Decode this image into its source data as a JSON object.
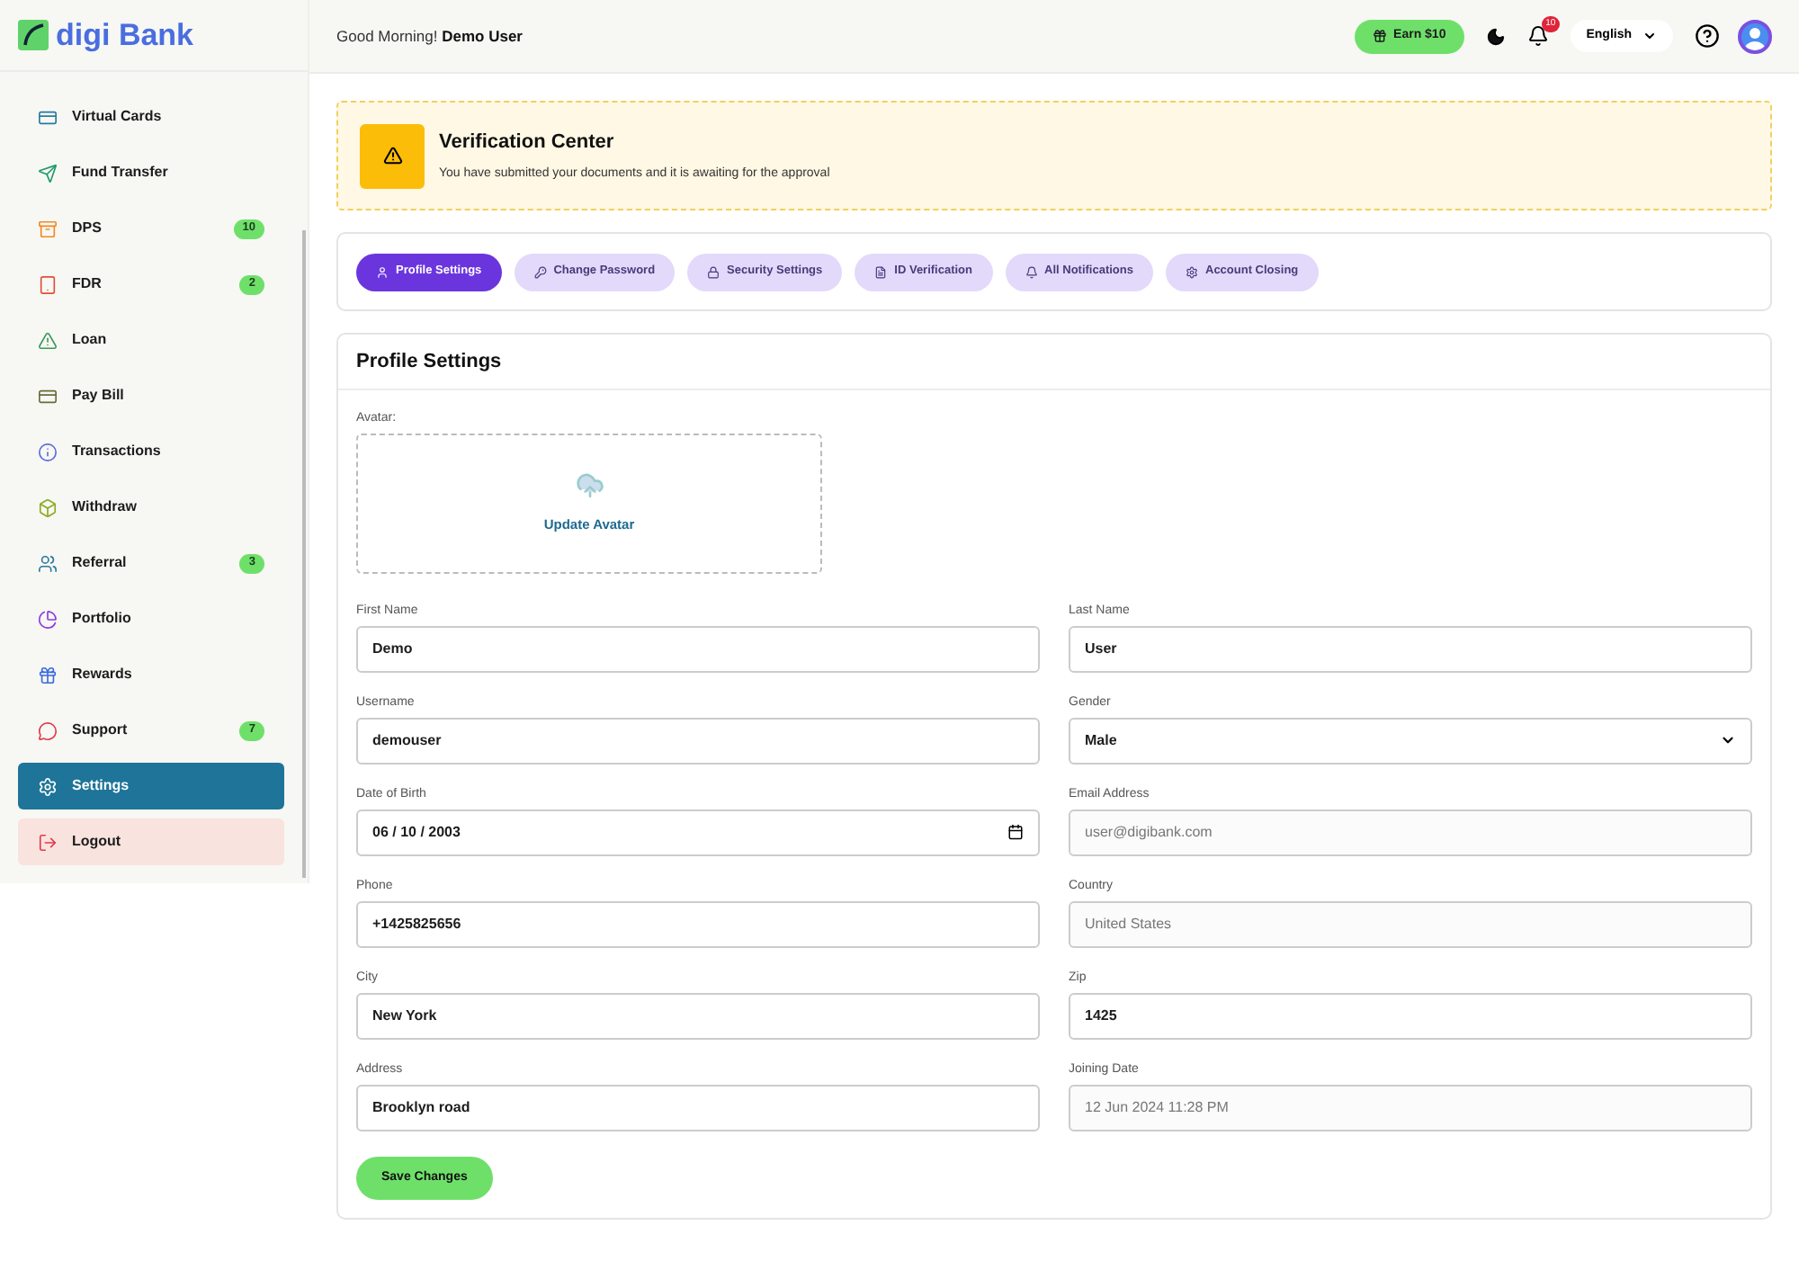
{
  "brand": {
    "name": "digi Bank"
  },
  "sidebar": {
    "items": [
      {
        "label": "Virtual Cards",
        "kind": "link",
        "selected": false
      },
      {
        "label": "Fund Transfer",
        "kind": "link",
        "selected": false
      },
      {
        "label": "DPS",
        "kind": "link",
        "selected": false,
        "badge": "10"
      },
      {
        "label": "FDR",
        "kind": "link",
        "selected": false,
        "badge": "2"
      },
      {
        "label": "Loan",
        "kind": "link",
        "selected": false
      },
      {
        "label": "Pay Bill",
        "kind": "link",
        "selected": false
      },
      {
        "label": "Transactions",
        "kind": "link",
        "selected": false
      },
      {
        "label": "Withdraw",
        "kind": "link",
        "selected": false
      },
      {
        "label": "Referral",
        "kind": "link",
        "selected": false,
        "badge": "3"
      },
      {
        "label": "Portfolio",
        "kind": "link",
        "selected": false
      },
      {
        "label": "Rewards",
        "kind": "link",
        "selected": false
      },
      {
        "label": "Support",
        "kind": "link",
        "selected": false,
        "badge": "7"
      },
      {
        "label": "Settings",
        "kind": "link",
        "selected": true
      },
      {
        "label": "Logout",
        "kind": "logout",
        "selected": false
      }
    ]
  },
  "header": {
    "greeting": "Good Morning!",
    "user": "Demo User",
    "earn_button": "Earn $10",
    "notification_count": "10",
    "language": "English"
  },
  "verification": {
    "title": "Verification Center",
    "message": "You have submitted your documents and it is awaiting for the approval"
  },
  "tabs": [
    {
      "label": "Profile Settings",
      "selected": true
    },
    {
      "label": "Change Password",
      "selected": false
    },
    {
      "label": "Security Settings",
      "selected": false
    },
    {
      "label": "ID Verification",
      "selected": false
    },
    {
      "label": "All Notifications",
      "selected": false
    },
    {
      "label": "Account Closing",
      "selected": false
    }
  ],
  "profile": {
    "title": "Profile Settings",
    "avatar_label": "Avatar:",
    "avatar_action": "Update Avatar",
    "fields": [
      {
        "label": "First Name",
        "value": "Demo",
        "kind": "text",
        "disabled": false
      },
      {
        "label": "Last Name",
        "value": "User",
        "kind": "text",
        "disabled": false
      },
      {
        "label": "Username",
        "value": "demouser",
        "kind": "text",
        "disabled": false
      },
      {
        "label": "Gender",
        "value": "Male",
        "kind": "select",
        "disabled": false
      },
      {
        "label": "Date of Birth",
        "value": "06 / 10 / 2003",
        "kind": "date",
        "disabled": false
      },
      {
        "label": "Email Address",
        "value": "user@digibank.com",
        "kind": "text",
        "disabled": true
      },
      {
        "label": "Phone",
        "value": "+1425825656",
        "kind": "text",
        "disabled": false
      },
      {
        "label": "Country",
        "value": "United States",
        "kind": "text",
        "disabled": true
      },
      {
        "label": "City",
        "value": "New York",
        "kind": "text",
        "disabled": false
      },
      {
        "label": "Zip",
        "value": "1425",
        "kind": "text",
        "disabled": false
      },
      {
        "label": "Address",
        "value": "Brooklyn road",
        "kind": "text",
        "disabled": false
      },
      {
        "label": "Joining Date",
        "value": "12 Jun 2024 11:28 PM",
        "kind": "text",
        "disabled": true
      }
    ],
    "save_button": "Save Changes"
  }
}
